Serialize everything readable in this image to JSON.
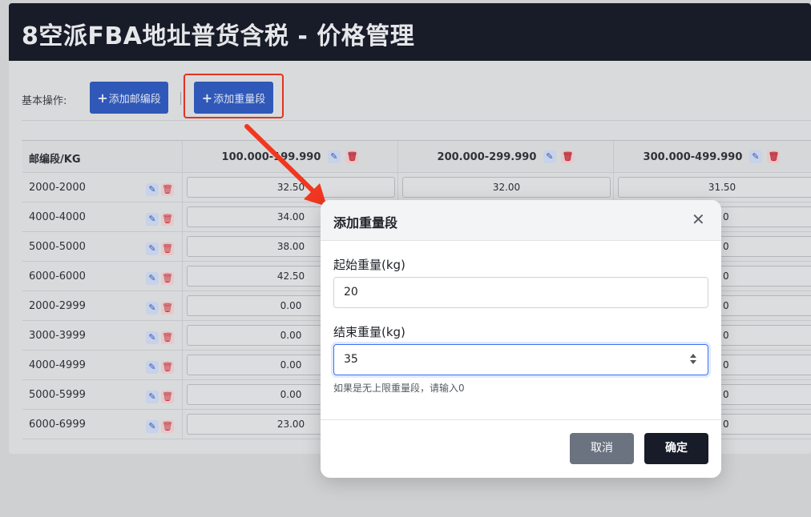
{
  "page": {
    "title": "8空派FBA地址普货含税 - 价格管理"
  },
  "toolbar": {
    "label": "基本操作:",
    "add_zip_label": "添加邮编段",
    "add_weight_label": "添加重量段",
    "plus_icon": "plus-icon"
  },
  "table": {
    "corner_header": "邮编段/KG",
    "weight_columns": [
      "100.000-199.990",
      "200.000-299.990",
      "300.000-499.990"
    ],
    "rows": [
      {
        "zip": "2000-2000",
        "prices": [
          "32.50",
          "32.00",
          "31.50"
        ]
      },
      {
        "zip": "4000-4000",
        "prices": [
          "34.00",
          "",
          ""
        ]
      },
      {
        "zip": "5000-5000",
        "prices": [
          "38.00",
          "",
          ""
        ]
      },
      {
        "zip": "6000-6000",
        "prices": [
          "42.50",
          "",
          ""
        ]
      },
      {
        "zip": "2000-2999",
        "prices": [
          "0.00",
          "",
          ""
        ]
      },
      {
        "zip": "3000-3999",
        "prices": [
          "0.00",
          "",
          ""
        ]
      },
      {
        "zip": "4000-4999",
        "prices": [
          "0.00",
          "",
          ""
        ]
      },
      {
        "zip": "5000-5999",
        "prices": [
          "0.00",
          "",
          ""
        ]
      },
      {
        "zip": "6000-6999",
        "prices": [
          "23.00",
          "",
          ""
        ]
      }
    ],
    "partial_suffix": "0"
  },
  "modal": {
    "title": "添加重量段",
    "close_glyph": "✕",
    "start_label": "起始重量(kg)",
    "start_value": "20",
    "end_label": "结束重量(kg)",
    "end_value": "35",
    "help": "如果是无上限重量段，请输入0",
    "cancel_label": "取消",
    "confirm_label": "确定"
  },
  "colors": {
    "header_bg": "#181c28",
    "primary_blue": "#2f58b8",
    "highlight_red": "#e0341f",
    "arrow_red": "#f1371f"
  }
}
